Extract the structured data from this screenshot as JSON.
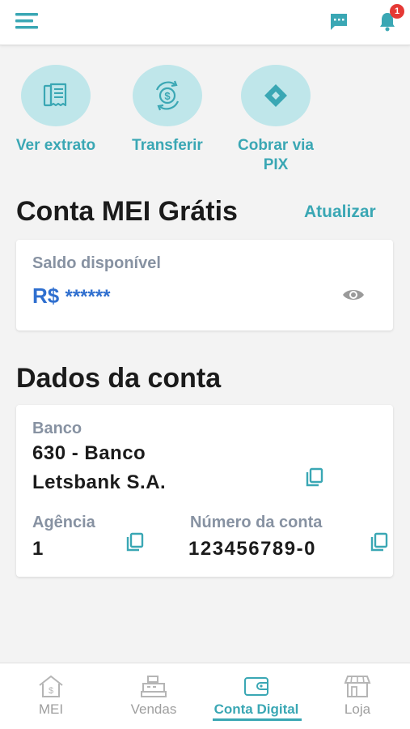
{
  "header": {
    "menu_icon": "menu-icon",
    "chat_icon": "chat-icon",
    "bell_icon": "bell-icon",
    "notification_count": "1",
    "accent_color": "#3aa7b4",
    "badge_color": "#e53935"
  },
  "quick_actions": [
    {
      "label": "Ver extrato",
      "icon": "receipt-icon"
    },
    {
      "label": "Transferir",
      "icon": "money-transfer-icon"
    },
    {
      "label": "Cobrar via PIX",
      "icon": "pix-icon"
    }
  ],
  "account": {
    "title": "Conta MEI Grátis",
    "refresh_label": "Atualizar",
    "balance_label": "Saldo disponível",
    "currency": "R$",
    "balance_masked": "******",
    "visibility_icon": "eye-icon"
  },
  "details": {
    "title": "Dados da conta",
    "bank_label": "Banco",
    "bank_line1": "630 - Banco",
    "bank_line2": "Letsbank S.A.",
    "agency_label": "Agência",
    "agency_value": "1",
    "account_label": "Número da conta",
    "account_value": "123456789-0",
    "copy_icon": "copy-icon"
  },
  "bottom_nav": [
    {
      "label": "MEI",
      "icon": "mei-house-icon",
      "active": false
    },
    {
      "label": "Vendas",
      "icon": "cash-register-icon",
      "active": false
    },
    {
      "label": "Conta Digital",
      "icon": "wallet-icon",
      "active": true
    },
    {
      "label": "Loja",
      "icon": "store-icon",
      "active": false
    }
  ]
}
